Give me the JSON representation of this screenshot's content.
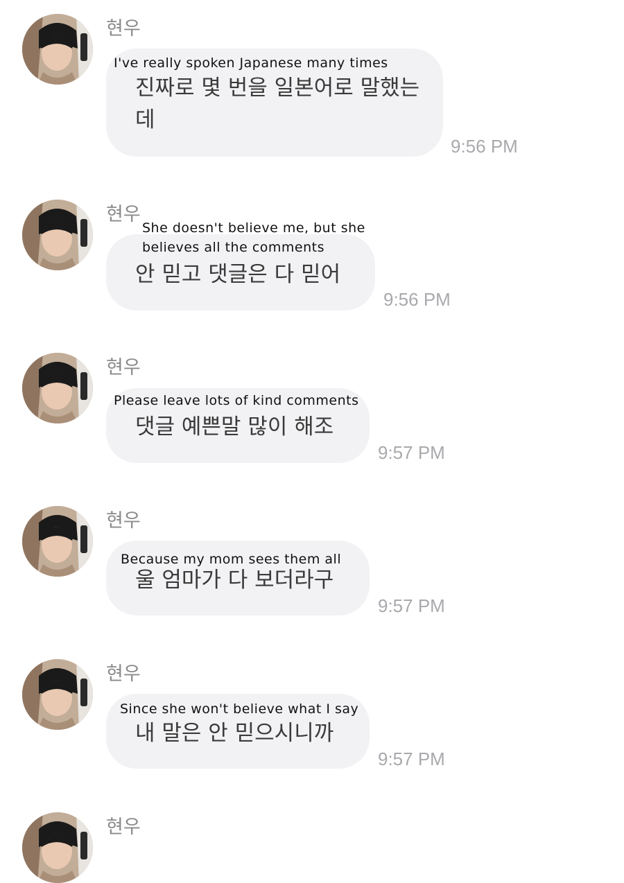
{
  "messages": [
    {
      "sender": "현우",
      "korean": "진짜로 몇 번을 일본어로 말했는데",
      "translation": "I've really spoken Japanese many times",
      "time": "9:56 PM"
    },
    {
      "sender": "현우",
      "korean": "안 믿고 댓글은 다 믿어",
      "translation": "She doesn't believe me, but she believes all the comments",
      "time": "9:56 PM"
    },
    {
      "sender": "현우",
      "korean": "댓글 예쁜말 많이 해조",
      "translation": "Please leave lots of kind comments",
      "time": "9:57 PM"
    },
    {
      "sender": "현우",
      "korean": "울 엄마가 다 보더라구",
      "translation": "Because my mom sees them all",
      "time": "9:57 PM"
    },
    {
      "sender": "현우",
      "korean": "내 말은 안 믿으시니까",
      "translation": "Since she won't believe what I say",
      "time": "9:57 PM"
    },
    {
      "sender": "현우"
    }
  ]
}
